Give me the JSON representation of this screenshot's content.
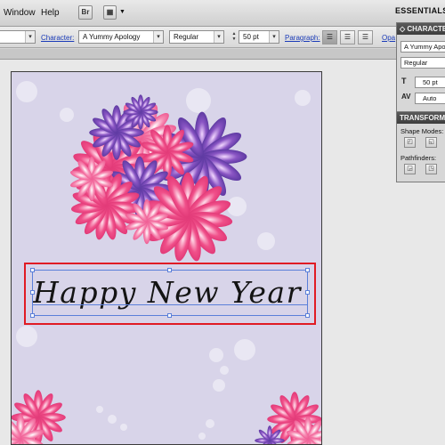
{
  "menubar": {
    "window_label": "Window",
    "help_label": "Help",
    "bridge_label": "Br",
    "arrange_label": "▦",
    "workspace_label": "ESSENTIALS"
  },
  "control_bar": {
    "character_label": "Character:",
    "font_family": "A Yummy Apology",
    "font_style": "Regular",
    "font_size": "50 pt",
    "paragraph_label": "Paragraph:",
    "opacity_label": "Opa"
  },
  "artboard": {
    "greeting_text": "Happy New Year"
  },
  "character_panel": {
    "title": "◇ CHARACTER",
    "font_family": "A Yummy Apology",
    "font_style": "Regular",
    "size_value": "50 pt",
    "tracking_value": "Auto"
  },
  "transform_panel": {
    "title": "TRANSFORM",
    "shape_modes_label": "Shape Modes:",
    "pathfinders_label": "Pathfinders:"
  },
  "colors": {
    "artboard_bg": "#d8d4e9",
    "flower_pink": "#f0508a",
    "flower_purple": "#7a4fb8",
    "selection_blue": "#5b7fd9",
    "highlight_red": "#e01b24"
  }
}
